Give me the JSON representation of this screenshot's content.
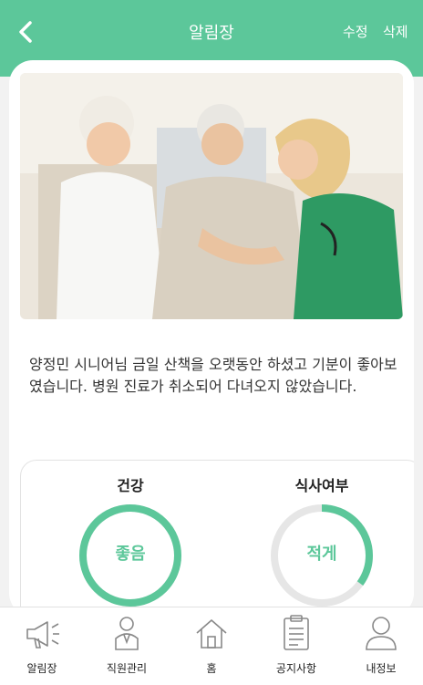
{
  "header": {
    "title": "알림장",
    "edit_label": "수정",
    "delete_label": "삭제",
    "back_icon": "chevron-left-icon",
    "color": "#5cc79a"
  },
  "post": {
    "text": "양정민 시니어님 금일 산책을 오랫동안 하셨고 기분이 좋아보였습니다. 병원 진료가 취소되어 다녀오지 않았습니다."
  },
  "stats": [
    {
      "label": "건강",
      "value": "좋음",
      "progress": 1.0
    },
    {
      "label": "식사여부",
      "value": "적게",
      "progress": 0.35
    }
  ],
  "tabbar": {
    "items": [
      {
        "label": "알림장",
        "icon": "megaphone-icon"
      },
      {
        "label": "직원관리",
        "icon": "staff-icon"
      },
      {
        "label": "홈",
        "icon": "home-icon"
      },
      {
        "label": "공지사항",
        "icon": "clipboard-icon"
      },
      {
        "label": "내정보",
        "icon": "person-icon"
      }
    ]
  }
}
